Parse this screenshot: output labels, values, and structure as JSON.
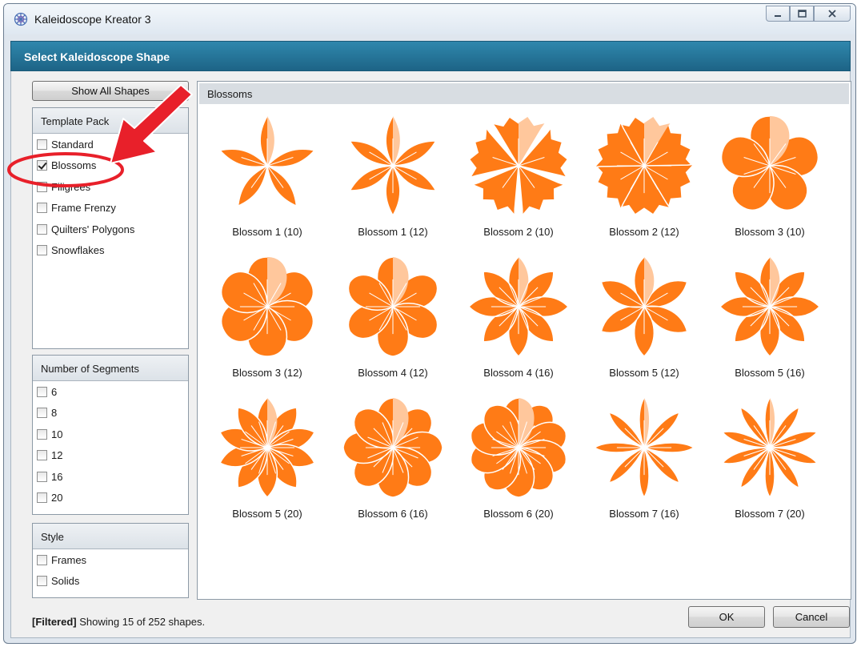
{
  "window": {
    "title": "Kaleidoscope Kreator 3"
  },
  "banner": {
    "title": "Select Kaleidoscope Shape"
  },
  "sidebar": {
    "show_all_label": "Show All Shapes",
    "template_pack": {
      "title": "Template Pack",
      "items": [
        {
          "label": "Standard",
          "checked": false
        },
        {
          "label": "Blossoms",
          "checked": true
        },
        {
          "label": "Filigrees",
          "checked": false
        },
        {
          "label": "Frame Frenzy",
          "checked": false
        },
        {
          "label": "Quilters' Polygons",
          "checked": false
        },
        {
          "label": "Snowflakes",
          "checked": false
        }
      ]
    },
    "segments": {
      "title": "Number of Segments",
      "items": [
        {
          "label": "6",
          "checked": false
        },
        {
          "label": "8",
          "checked": false
        },
        {
          "label": "10",
          "checked": false
        },
        {
          "label": "12",
          "checked": false
        },
        {
          "label": "16",
          "checked": false
        },
        {
          "label": "20",
          "checked": false
        }
      ]
    },
    "style": {
      "title": "Style",
      "items": [
        {
          "label": "Frames",
          "checked": false
        },
        {
          "label": "Solids",
          "checked": false
        }
      ]
    }
  },
  "gallery": {
    "header": "Blossoms",
    "shapes": [
      {
        "label": "Blossom 1 (10)",
        "petals": 5,
        "kind": "star"
      },
      {
        "label": "Blossom 1 (12)",
        "petals": 6,
        "kind": "star"
      },
      {
        "label": "Blossom 2 (10)",
        "petals": 5,
        "kind": "carnation"
      },
      {
        "label": "Blossom 2 (12)",
        "petals": 6,
        "kind": "carnation"
      },
      {
        "label": "Blossom 3 (10)",
        "petals": 5,
        "kind": "scalloped"
      },
      {
        "label": "Blossom 3 (12)",
        "petals": 6,
        "kind": "scalloped"
      },
      {
        "label": "Blossom 4 (12)",
        "petals": 6,
        "kind": "round"
      },
      {
        "label": "Blossom 4 (16)",
        "petals": 8,
        "kind": "pointed"
      },
      {
        "label": "Blossom 5 (12)",
        "petals": 6,
        "kind": "pointed"
      },
      {
        "label": "Blossom 5 (16)",
        "petals": 8,
        "kind": "pointed"
      },
      {
        "label": "Blossom 5 (20)",
        "petals": 10,
        "kind": "pointed"
      },
      {
        "label": "Blossom 6 (16)",
        "petals": 8,
        "kind": "round"
      },
      {
        "label": "Blossom 6 (20)",
        "petals": 10,
        "kind": "round"
      },
      {
        "label": "Blossom 7 (16)",
        "petals": 8,
        "kind": "narrow"
      },
      {
        "label": "Blossom 7 (20)",
        "petals": 10,
        "kind": "narrow"
      }
    ]
  },
  "status": {
    "filtered_tag": "[Filtered]",
    "text": " Showing 15 of 252 shapes."
  },
  "buttons": {
    "ok": "OK",
    "cancel": "Cancel"
  },
  "colors": {
    "shape_orange": "#ff7b16",
    "shape_light": "#ffc79c",
    "banner": "#2475a0",
    "annotation_red": "#e8202a"
  },
  "icons": {
    "app": "kaleidoscope-icon",
    "checkbox": "checkbox-icon"
  }
}
